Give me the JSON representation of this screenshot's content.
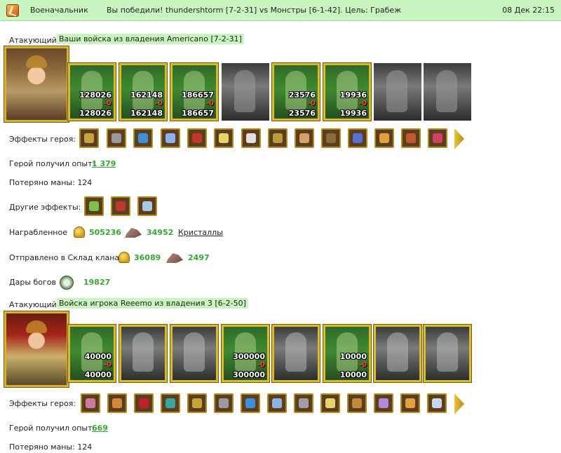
{
  "header": {
    "category": "Военачальник",
    "message": "Вы победили! thundershtorm [7-2-31] vs Монстры [6-1-42]. Цель: Грабеж",
    "time": "08 Дек 22:15"
  },
  "block1": {
    "side_label": "Атакующий",
    "side_tag": "Ваши войска из владения Americano [7-2-31]",
    "troops": [
      {
        "top": "128026",
        "loss": "-0",
        "bottom": "128026"
      },
      {
        "top": "162148",
        "loss": "-0",
        "bottom": "162148"
      },
      {
        "top": "186657",
        "loss": "-0",
        "bottom": "186657"
      },
      {
        "top": "",
        "loss": "",
        "bottom": ""
      },
      {
        "top": "23576",
        "loss": "-0",
        "bottom": "23576"
      },
      {
        "top": "19936",
        "loss": "-0",
        "bottom": "19936"
      },
      {
        "top": "",
        "loss": "",
        "bottom": ""
      },
      {
        "top": "",
        "loss": "",
        "bottom": ""
      }
    ],
    "effects_label": "Эффекты героя:",
    "exp_label": "Герой получил опыт:",
    "exp_value": "1 379",
    "mana_text": "Потеряно маны: 124",
    "other_label": "Другие эффекты:",
    "loot_label": "Награбленное",
    "loot_gold": "505236",
    "loot_cryst": "34952",
    "loot_cryst_link": "Кристаллы",
    "sent_label": "Отправлено в Склад клана",
    "sent_gold": "36089",
    "sent_cryst": "2497",
    "gods_label": "Дары богов",
    "gods_value": "19827"
  },
  "block2": {
    "side_label": "Атакующий",
    "side_tag": "Войска игрока Reeemo из владения 3 [6-2-50]",
    "troops": [
      {
        "top": "40000",
        "loss": "-0",
        "bottom": "40000"
      },
      {
        "top": "",
        "loss": "",
        "bottom": ""
      },
      {
        "top": "",
        "loss": "",
        "bottom": ""
      },
      {
        "top": "300000",
        "loss": "-0",
        "bottom": "300000"
      },
      {
        "top": "",
        "loss": "",
        "bottom": ""
      },
      {
        "top": "10000",
        "loss": "-0",
        "bottom": "10000"
      },
      {
        "top": "",
        "loss": "",
        "bottom": ""
      },
      {
        "top": "",
        "loss": "",
        "bottom": ""
      }
    ],
    "effects_label": "Эффекты героя:",
    "exp_label": "Герой получил опыт:",
    "exp_value": "669",
    "mana_text": "Потеряно маны: 124"
  }
}
